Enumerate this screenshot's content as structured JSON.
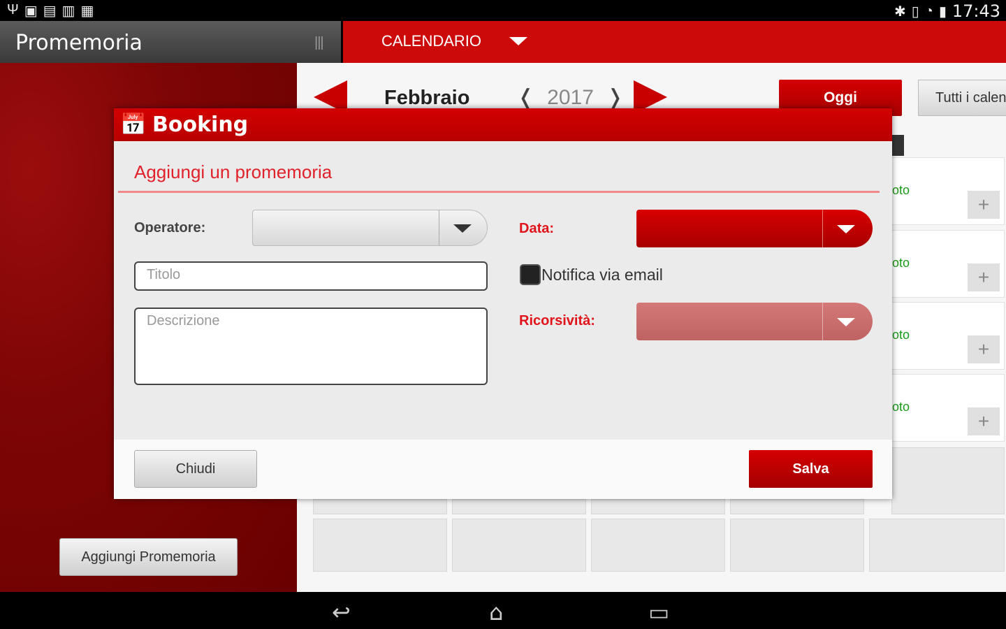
{
  "status_bar": {
    "left_icons": [
      "usb-icon",
      "image-icon",
      "document-icon",
      "upload-icon",
      "briefcase-icon"
    ],
    "left_glyphs": [
      "Ψ",
      "▣",
      "▤",
      "▥",
      "▦"
    ],
    "right_glyphs": [
      "✱",
      "▯",
      "◔",
      "▮"
    ],
    "time": "17:43"
  },
  "app_bar": {
    "title": "Promemoria",
    "drawer_glyph": "|||",
    "calendar_dropdown": "CALENDARIO",
    "accent": "#cc0a0a"
  },
  "calendar": {
    "month": "Febbraio",
    "year": "2017",
    "prev_year_glyph": "❬",
    "next_year_glyph": "❭",
    "today_button": "Oggi",
    "all_calendars_button": "Tutti i calendari",
    "slot_text": "oto",
    "plus_glyph": "+"
  },
  "left_panel": {
    "add_button": "Aggiungi Promemoria"
  },
  "modal": {
    "icon_glyph": "📅",
    "title": "Booking",
    "section_title": "Aggiungi un promemoria",
    "operator_label": "Operatore:",
    "title_placeholder": "Titolo",
    "description_placeholder": "Descrizione",
    "date_label": "Data:",
    "email_notify_label": "Notifica via email",
    "recurrence_label": "Ricorsività:",
    "close_button": "Chiudi",
    "save_button": "Salva"
  },
  "nav_bar": {
    "back_glyph": "↩",
    "home_glyph": "⌂",
    "recents_glyph": "▭"
  }
}
